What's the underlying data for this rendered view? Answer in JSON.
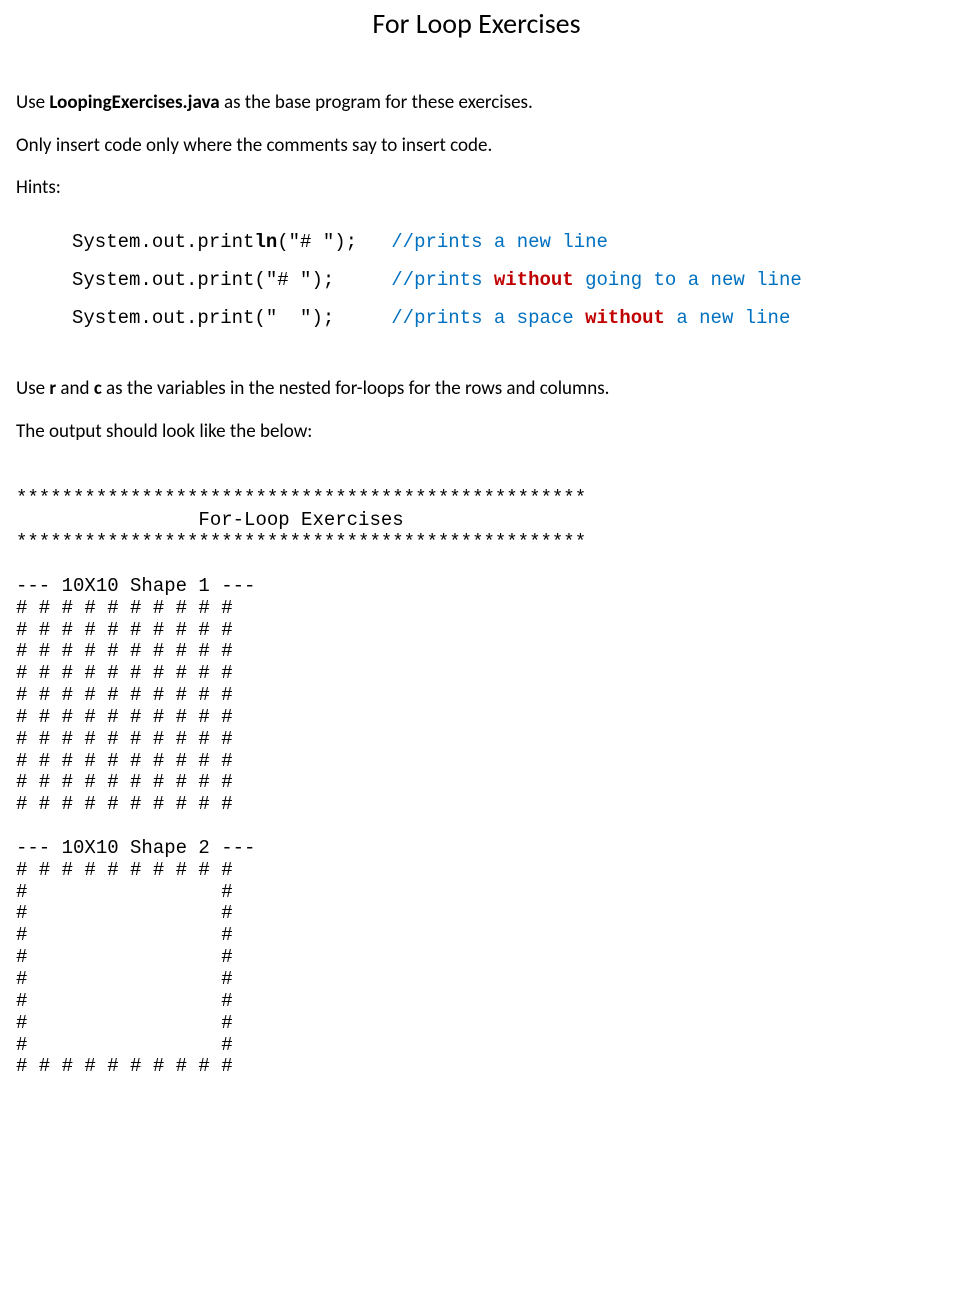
{
  "title": "For Loop Exercises",
  "para1_pre": "Use ",
  "para1_bold": "LoopingExercises.java",
  "para1_post": " as the base program for these exercises.",
  "para2": "Only insert code only where the comments say to insert code.",
  "para3": "Hints:",
  "hints": {
    "l1_code_a": "System.out.print",
    "l1_code_b": "ln",
    "l1_code_c": "(\"# \");   ",
    "l1_comment": "//prints a new line",
    "l2_code": "System.out.print(\"# \");     ",
    "l2_comment_a": "//prints ",
    "l2_comment_b": "without",
    "l2_comment_c": " going to a new line",
    "l3_code": "System.out.print(\"  \");     ",
    "l3_comment_a": "//prints a space ",
    "l3_comment_b": "without",
    "l3_comment_c": " a new line"
  },
  "para4_a": "Use ",
  "para4_b": "r",
  "para4_c": " and ",
  "para4_d": "c",
  "para4_e": " as the variables in the nested for-loops for the rows and columns.",
  "para5": "The output should look like the below:",
  "output": "**************************************************\n                For-Loop Exercises\n**************************************************\n\n--- 10X10 Shape 1 ---\n# # # # # # # # # #\n# # # # # # # # # #\n# # # # # # # # # #\n# # # # # # # # # #\n# # # # # # # # # #\n# # # # # # # # # #\n# # # # # # # # # #\n# # # # # # # # # #\n# # # # # # # # # #\n# # # # # # # # # #\n\n--- 10X10 Shape 2 ---\n# # # # # # # # # #\n#                 #\n#                 #\n#                 #\n#                 #\n#                 #\n#                 #\n#                 #\n#                 #\n# # # # # # # # # #"
}
